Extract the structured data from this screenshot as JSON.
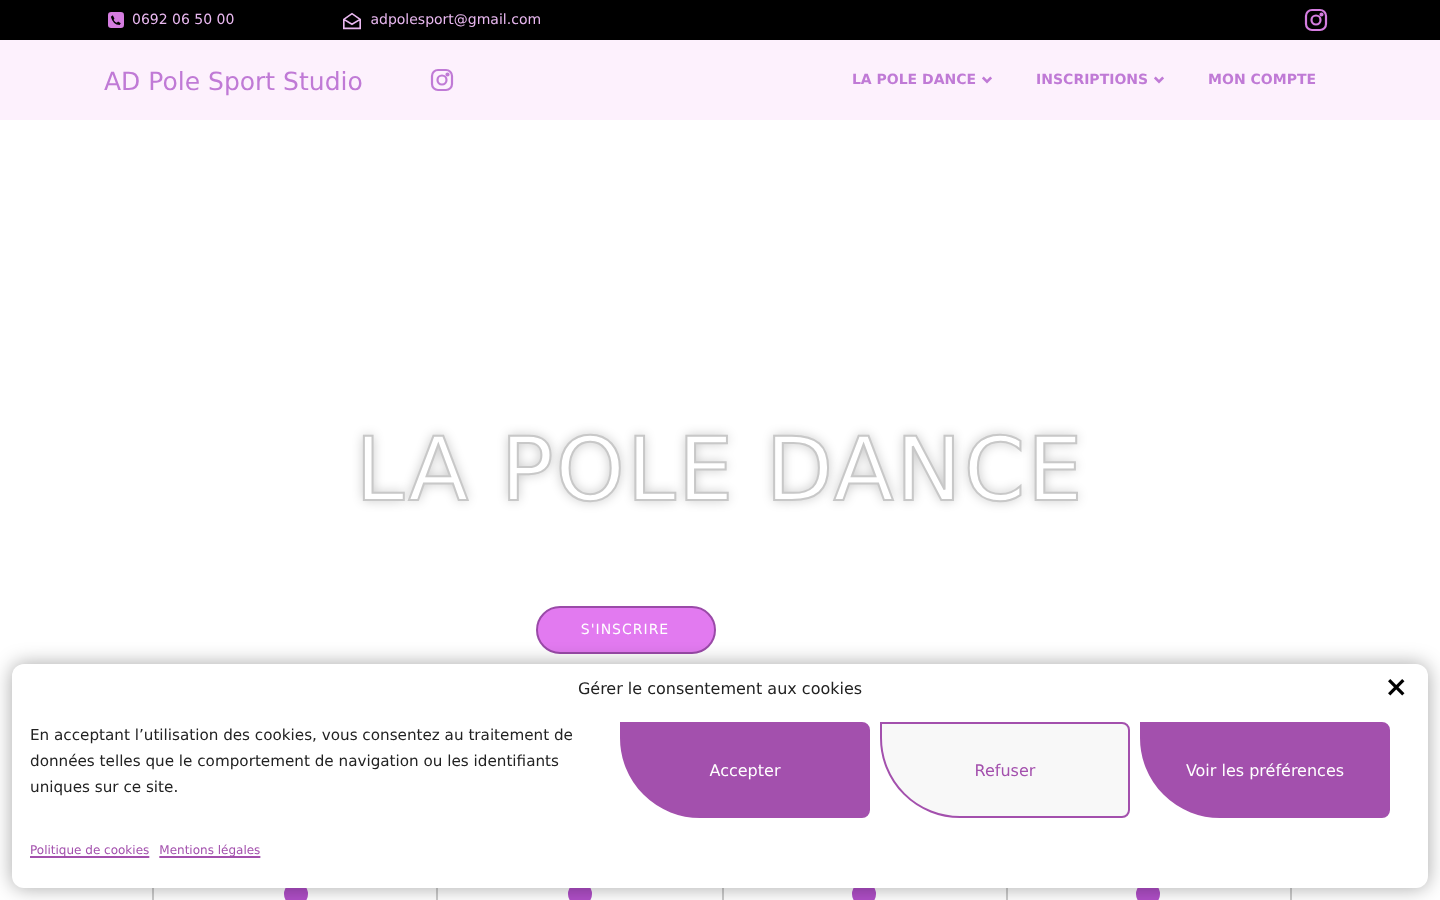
{
  "top_bar": {
    "phone": "0692 06 50 00",
    "email": "adpolesport@gmail.com"
  },
  "header": {
    "logo": "AD Pole Sport Studio",
    "menu": [
      {
        "label": "LA POLE DANCE",
        "has_dropdown": true
      },
      {
        "label": "INSCRIPTIONS",
        "has_dropdown": true
      },
      {
        "label": "MON COMPTE",
        "has_dropdown": false
      }
    ]
  },
  "hero": {
    "title": "LA POLE DANCE",
    "button": "S'INSCRIRE"
  },
  "cookie_banner": {
    "title": "Gérer le consentement aux cookies",
    "close": "×",
    "message": "En acceptant l’utilisation des cookies, vous consentez au traitement de données telles que le comportement de navigation ou les identifiants uniques sur ce site.",
    "buttons": [
      {
        "label": "Accepter",
        "kind": "primary"
      },
      {
        "label": "Refuser",
        "kind": "secondary"
      },
      {
        "label": "Voir les préférences",
        "kind": "primary"
      }
    ],
    "links": [
      "Politique de cookies",
      "Mentions légales"
    ]
  }
}
